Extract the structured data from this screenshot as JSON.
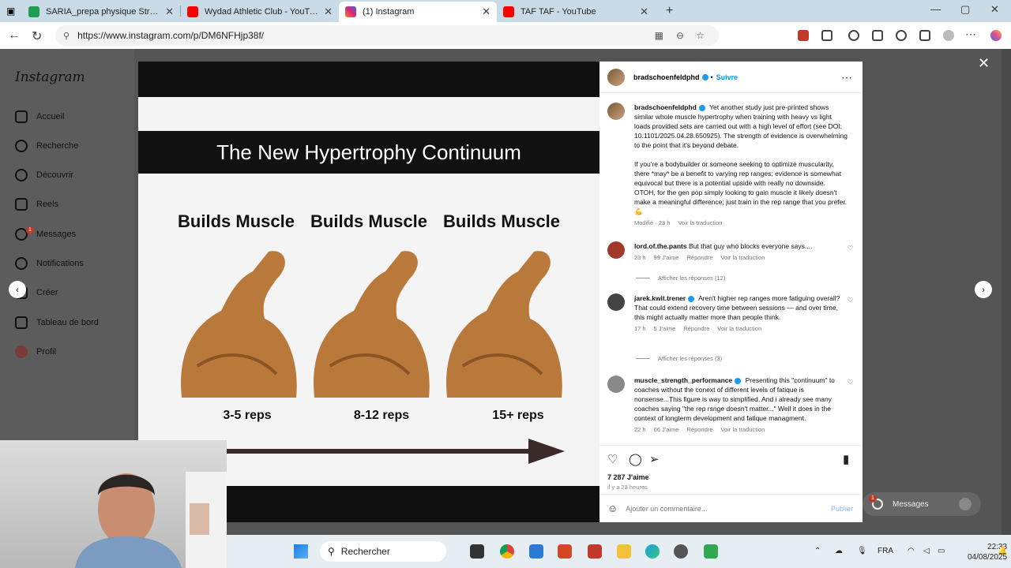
{
  "browser": {
    "tabs": [
      {
        "title": "SARIA_prepa physique Stream - \\",
        "favicon_color": "#1f9d55"
      },
      {
        "title": "Wydad Athletic Club - YouTube",
        "favicon_color": "#ff0000"
      },
      {
        "title": "(1) Instagram",
        "favicon_color": "#d62976"
      },
      {
        "title": "TAF TAF - YouTube",
        "favicon_color": "#ff0000"
      }
    ],
    "url": "https://www.instagram.com/p/DM6NFHjp38f/"
  },
  "sidebar": {
    "logo": "Instagram",
    "items": [
      {
        "label": "Accueil",
        "icon": "home-icon"
      },
      {
        "label": "Recherche",
        "icon": "search-icon"
      },
      {
        "label": "Découvrir",
        "icon": "compass-icon"
      },
      {
        "label": "Reels",
        "icon": "reels-icon"
      },
      {
        "label": "Messages",
        "icon": "messenger-icon",
        "badge": "1"
      },
      {
        "label": "Notifications",
        "icon": "heart-icon"
      },
      {
        "label": "Créer",
        "icon": "plus-icon"
      },
      {
        "label": "Tableau de bord",
        "icon": "chart-icon"
      },
      {
        "label": "Profil",
        "icon": "avatar-icon"
      }
    ]
  },
  "post_image": {
    "title": "The New Hypertrophy Continuum",
    "columns": [
      {
        "heading": "Builds Muscle",
        "reps": "3-5 reps"
      },
      {
        "heading": "Builds Muscle",
        "reps": "8-12 reps"
      },
      {
        "heading": "Builds Muscle",
        "reps": "15+ reps"
      }
    ]
  },
  "panel": {
    "author": "bradschoenfeldphd",
    "follow": "Suivre",
    "caption": {
      "username": "bradschoenfeldphd",
      "p1": "Yet another study just pre-printed shows similar whole muscle hypertrophy when training with heavy vs light loads provided sets are carried out with a high level of effort (see DOI: 10.1101/2025.04.28.650925). The strength of evidence is overwhelming to the point that it's beyond debate.",
      "p2": "If you're a bodybuilder or someone seeking to optimize muscularity, there *may* be a benefit to varying rep ranges; evidence is somewhat equivocal but there is a potential upside with really no downside. OTOH, for the gen pop simply looking to gain muscle it likely doesn't make a meaningful difference; just train in the rep range that you prefer. 💪",
      "modified": "Modifié · 23 h",
      "translate": "Voir la traduction"
    },
    "comments": [
      {
        "username": "lord.of.the.pants",
        "text": "But that guy who blocks everyone says....",
        "time": "23 h",
        "likes": "99 J'aime",
        "reply": "Répondre",
        "translate": "Voir la traduction",
        "replies": "Afficher les réponses (12)"
      },
      {
        "username": "jarek.kwit.trener",
        "text": "Aren't higher rep ranges more fatiguing overall? That could extend recovery time between sessions — and over time, this might actually matter more than people think.",
        "time": "17 h",
        "likes": "5 J'aime",
        "reply": "Répondre",
        "translate": "Voir la traduction",
        "replies": "Afficher les réponses (3)"
      },
      {
        "username": "muscle_strength_performance",
        "text": "Presenting this \"continuum\" to coaches without the conext of different levels of fatique is nonsense...This figure is way to simplified. And i already see many coaches saying \"the rep rsnge doesn't matter...\" Well it does in the context of longterm development and fatique managment.",
        "time": "22 h",
        "likes": "66 J'aime",
        "reply": "Répondre",
        "translate": "Voir la traduction"
      }
    ],
    "likes": "7 287 J'aime",
    "ago": "il y a 23 heures",
    "comment_placeholder": "Ajouter un commentaire...",
    "publish": "Publier"
  },
  "messages_pill": {
    "label": "Messages",
    "badge": "1"
  },
  "taskbar": {
    "search": "Rechercher",
    "lang": "FRA",
    "time": "22:33",
    "date": "04/08/2025"
  }
}
